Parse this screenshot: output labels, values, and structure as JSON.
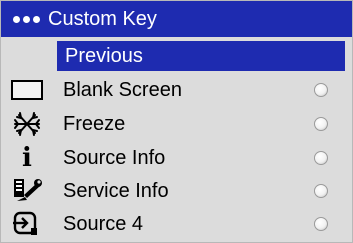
{
  "menu": {
    "title": "Custom Key",
    "selected_label": "Previous",
    "items": [
      {
        "label": "Blank Screen",
        "icon": "blank-screen-icon"
      },
      {
        "label": "Freeze",
        "icon": "freeze-icon"
      },
      {
        "label": "Source Info",
        "icon": "info-icon"
      },
      {
        "label": "Service Info",
        "icon": "service-icon"
      },
      {
        "label": "Source 4",
        "icon": "source-input-icon"
      }
    ],
    "info_glyph": "i",
    "colors": {
      "header_bg": "#1e2bb0",
      "menu_bg": "#dcdcdc"
    }
  }
}
